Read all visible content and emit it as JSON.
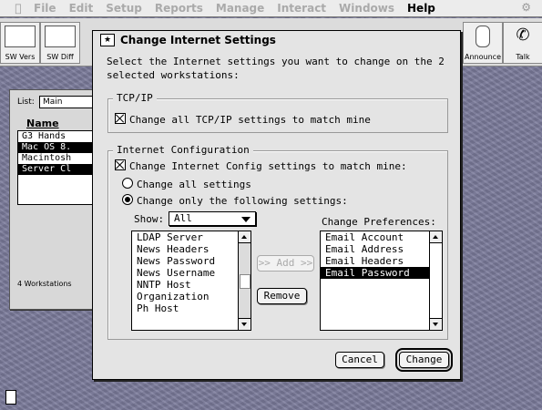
{
  "menubar": {
    "items": [
      "File",
      "Edit",
      "Setup",
      "Reports",
      "Manage",
      "Interact",
      "Windows",
      "Help"
    ],
    "active_index": 7
  },
  "toolbar": {
    "buttons": [
      {
        "label": "SW Vers",
        "icon": "window-icon"
      },
      {
        "label": "SW Diff",
        "icon": "diff-icon"
      },
      {
        "label": "Announce",
        "icon": "microphone-icon"
      },
      {
        "label": "Talk",
        "icon": "phone-icon"
      }
    ]
  },
  "background_window": {
    "list_label": "List:",
    "list_value": "Main",
    "column_header": "Name",
    "rows": [
      {
        "text": "G3 Hands",
        "selected": false
      },
      {
        "text": "Mac OS 8.",
        "selected": true
      },
      {
        "text": "Macintosh",
        "selected": false
      },
      {
        "text": "Server Cl",
        "selected": true
      }
    ],
    "count": "4 Workstations"
  },
  "dialog": {
    "title": "Change Internet Settings",
    "description": "Select the Internet settings you want to  change on the 2 selected workstations:",
    "tcpip": {
      "group_label": "TCP/IP",
      "checkbox_label": "Change all TCP/IP settings to match mine",
      "checked": true
    },
    "internet_config": {
      "group_label": "Internet Configuration",
      "checkbox_label": "Change Internet Config settings to match mine:",
      "checked": true,
      "radio_all": "Change all settings",
      "radio_some": "Change only the following settings:",
      "selected_radio": "some",
      "show_label": "Show:",
      "show_value": "All",
      "available_items": [
        "LDAP Server",
        "News Headers",
        "News Password",
        "News Username",
        "NNTP Host",
        "Organization",
        "Ph Host"
      ],
      "add_button": ">> Add >>",
      "remove_button": "Remove",
      "preferences_label": "Change Preferences:",
      "selected_items": [
        {
          "text": "Email Account",
          "selected": false
        },
        {
          "text": "Email Address",
          "selected": false
        },
        {
          "text": "Email Headers",
          "selected": false
        },
        {
          "text": "Email Password",
          "selected": true
        }
      ]
    },
    "cancel_button": "Cancel",
    "change_button": "Change"
  }
}
